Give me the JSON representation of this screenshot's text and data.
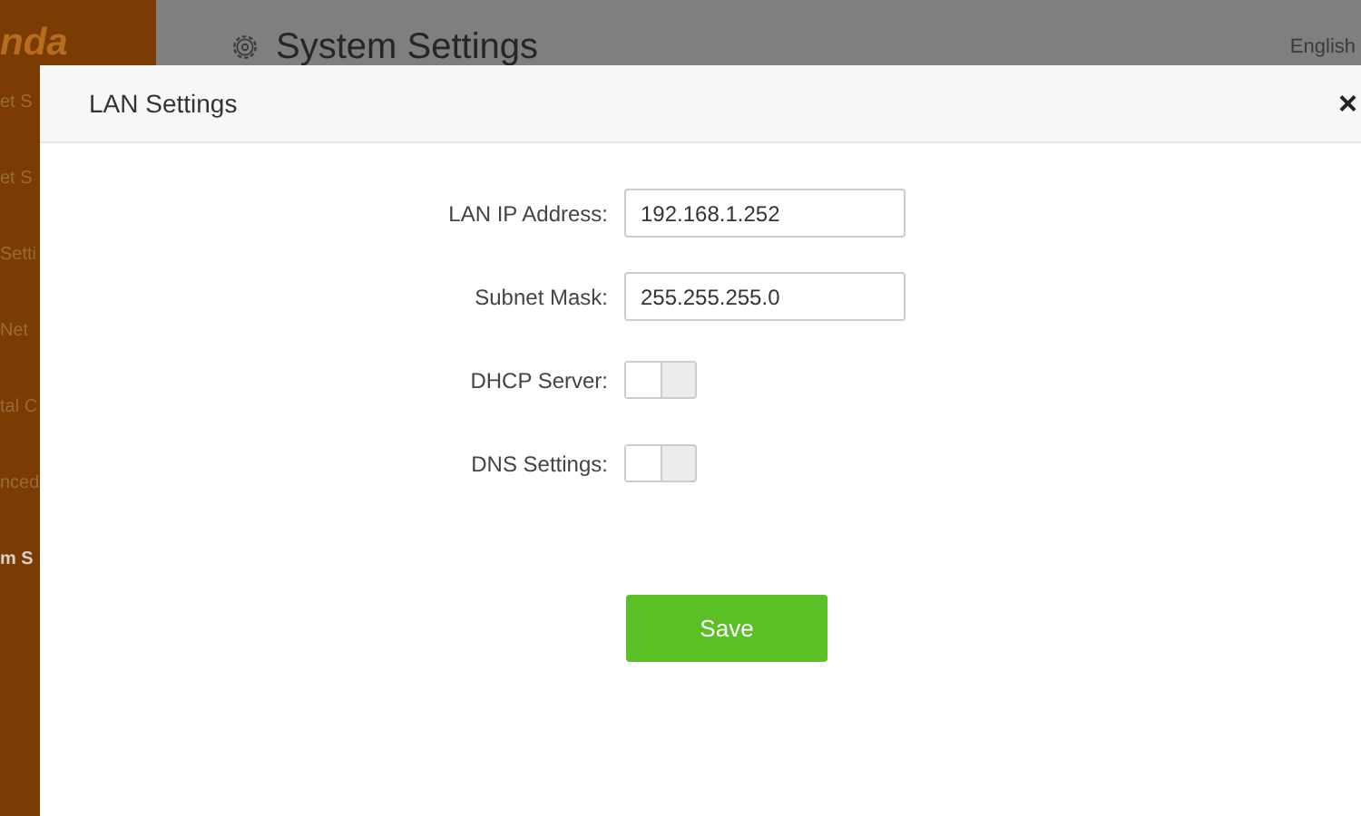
{
  "logo": "nda",
  "sidebar": {
    "items": [
      {
        "label": "et S",
        "selected": false
      },
      {
        "label": "et S",
        "selected": false
      },
      {
        "label": "Setti",
        "selected": false
      },
      {
        "label": "Net",
        "selected": false
      },
      {
        "label": "tal C",
        "selected": false
      },
      {
        "label": "nced",
        "selected": false
      },
      {
        "label": "m S",
        "selected": true
      }
    ]
  },
  "header": {
    "title": "System Settings",
    "language": "English"
  },
  "dialog": {
    "title": "LAN Settings",
    "close": "×",
    "fields": [
      {
        "kind": "text",
        "label": "LAN IP Address:",
        "value": "192.168.1.252"
      },
      {
        "kind": "text",
        "label": "Subnet Mask:",
        "value": "255.255.255.0"
      },
      {
        "kind": "toggle",
        "label": "DHCP Server:",
        "on": false
      },
      {
        "kind": "toggle",
        "label": "DNS Settings:",
        "on": false
      }
    ],
    "button": "Save"
  }
}
